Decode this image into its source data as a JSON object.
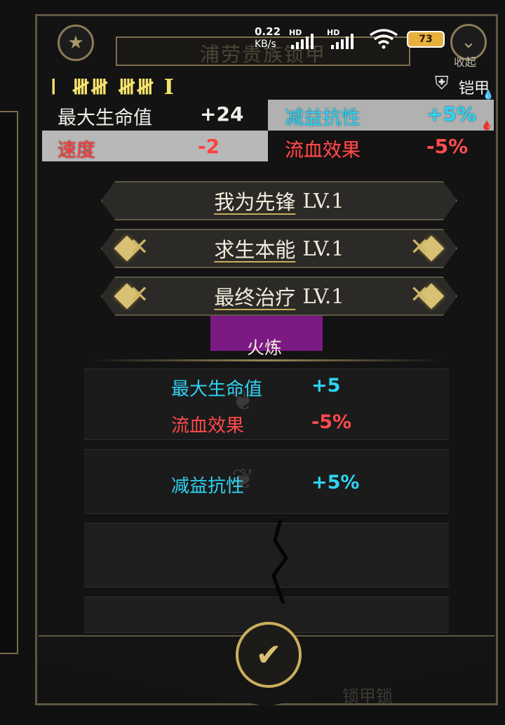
{
  "status_bar": {
    "speed_value": "0.22",
    "speed_unit": "KB/s",
    "network_1": "HD",
    "network_2": "HD",
    "battery": "73"
  },
  "header": {
    "title": "浦劳贵族锁甲",
    "collapse_label": "收起",
    "star_icon": "star-icon",
    "collapse_icon": "chevron-down-icon"
  },
  "item": {
    "tally": "𝍷 𝍸𝍸 𝍸𝍸 I",
    "armor_label": "铠甲",
    "armor_icon": "armor-icon"
  },
  "stats": [
    {
      "name": "最大生命值",
      "value": "+24",
      "color": "#f0eee6"
    },
    {
      "name": "减益抗性",
      "value": "+5%",
      "color": "#2fd3f2"
    },
    {
      "name": "速度",
      "value": "-2",
      "color": "#ff4040"
    },
    {
      "name": "流血效果",
      "value": "-5%",
      "color": "#ff4d4d"
    }
  ],
  "skills": [
    {
      "name": "我为先锋",
      "level": "LV.1"
    },
    {
      "name": "求生本能",
      "level": "LV.1"
    },
    {
      "name": "最终治疗",
      "level": "LV.1"
    }
  ],
  "fire": {
    "label": "火炼",
    "bonuses": [
      {
        "name": "最大生命值",
        "value": "+5",
        "color": "#2fd3f2"
      },
      {
        "name": "流血效果",
        "value": "-5%",
        "color": "#ff4a4a"
      },
      {
        "name": "减益抗性",
        "value": "+5%",
        "color": "#2fd3f2"
      }
    ]
  },
  "footer": {
    "confirm_icon": "checkmark-icon",
    "background_text": "锁甲锁"
  },
  "colors": {
    "gold": "#c9ae5c",
    "cyan": "#2fd3f2",
    "red": "#ff4a4a",
    "frame": "#5e5640"
  }
}
